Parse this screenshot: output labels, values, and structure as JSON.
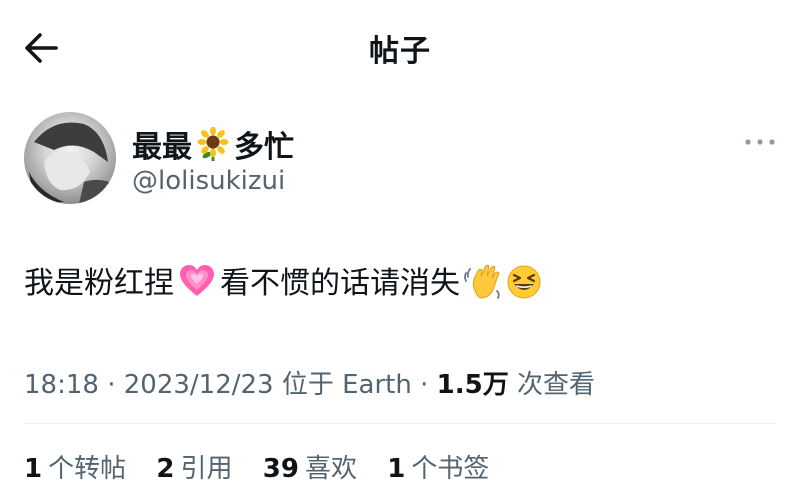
{
  "header": {
    "title": "帖子"
  },
  "author": {
    "name_part1": "最最",
    "name_part2": "多忙",
    "handle": "@lolisukizui"
  },
  "post": {
    "text_part1": "我是粉红捏",
    "text_part2": "看不惯的话请消失"
  },
  "meta": {
    "time": "18:18",
    "date": "2023/12/23",
    "location": "位于 Earth",
    "views_count": "1.5万",
    "views_label": "次查看"
  },
  "stats": {
    "reposts_count": "1",
    "reposts_label": "个转帖",
    "quotes_count": "2",
    "quotes_label": "引用",
    "likes_count": "39",
    "likes_label": "喜欢",
    "bookmarks_count": "1",
    "bookmarks_label": "个书签"
  },
  "icons": {
    "back": "arrow-left-icon",
    "more": "more-horizontal-icon",
    "name_emoji": "sunflower-emoji",
    "heart_emoji": "growing-heart-emoji",
    "wave_emoji": "waving-hand-emoji",
    "laugh_emoji": "grinning-squinting-face-emoji"
  },
  "colors": {
    "text": "#0f1419",
    "secondary": "#536471",
    "heart": "#ff4fa0"
  }
}
